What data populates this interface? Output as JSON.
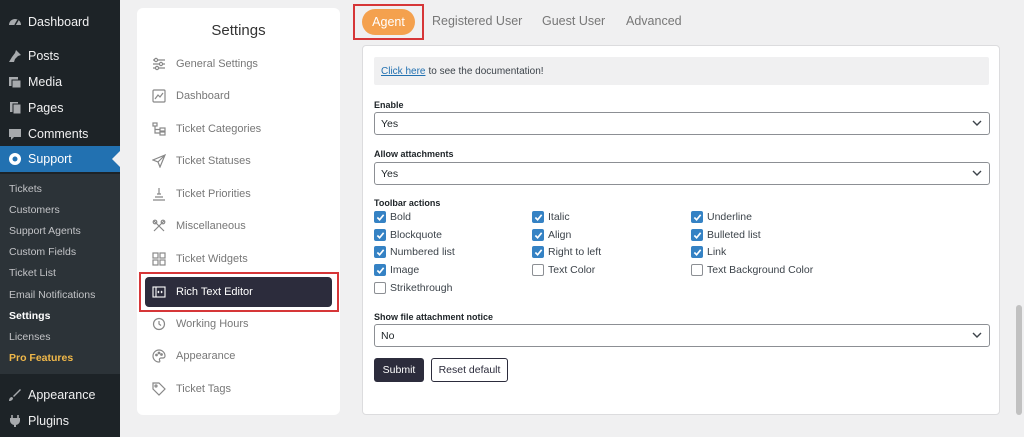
{
  "wp_menu": {
    "items": [
      {
        "label": "Dashboard",
        "icon": "dashboard-icon"
      },
      {
        "label": "Posts",
        "icon": "pin-icon"
      },
      {
        "label": "Media",
        "icon": "media-icon"
      },
      {
        "label": "Pages",
        "icon": "pages-icon"
      },
      {
        "label": "Comments",
        "icon": "comment-icon"
      },
      {
        "label": "Support",
        "icon": "lifebuoy-icon"
      },
      {
        "label": "Appearance",
        "icon": "brush-icon"
      },
      {
        "label": "Plugins",
        "icon": "plug-icon"
      }
    ],
    "submenu": [
      "Tickets",
      "Customers",
      "Support Agents",
      "Custom Fields",
      "Ticket List",
      "Email Notifications",
      "Settings",
      "Licenses",
      "Pro Features"
    ]
  },
  "settings_nav": {
    "title": "Settings",
    "items": [
      {
        "label": "General Settings",
        "icon": "sliders-icon"
      },
      {
        "label": "Dashboard",
        "icon": "chart-icon"
      },
      {
        "label": "Ticket Categories",
        "icon": "tree-icon"
      },
      {
        "label": "Ticket Statuses",
        "icon": "send-icon"
      },
      {
        "label": "Ticket Priorities",
        "icon": "priority-icon"
      },
      {
        "label": "Miscellaneous",
        "icon": "tools-icon"
      },
      {
        "label": "Ticket Widgets",
        "icon": "widgets-icon"
      },
      {
        "label": "Rich Text Editor",
        "icon": "code-editor-icon"
      },
      {
        "label": "Working Hours",
        "icon": "clock-icon"
      },
      {
        "label": "Appearance",
        "icon": "palette-icon"
      },
      {
        "label": "Ticket Tags",
        "icon": "tag-icon"
      }
    ]
  },
  "tabs": [
    "Agent",
    "Registered User",
    "Guest User",
    "Advanced"
  ],
  "form": {
    "doc_link": "Click here",
    "doc_text": "to see the documentation!",
    "enable_label": "Enable",
    "enable_value": "Yes",
    "attach_label": "Allow attachments",
    "attach_value": "Yes",
    "toolbar_label": "Toolbar actions",
    "toolbar": [
      {
        "label": "Bold",
        "checked": true
      },
      {
        "label": "Italic",
        "checked": true
      },
      {
        "label": "Underline",
        "checked": true
      },
      {
        "label": "Blockquote",
        "checked": true
      },
      {
        "label": "Align",
        "checked": true
      },
      {
        "label": "Bulleted list",
        "checked": true
      },
      {
        "label": "Numbered list",
        "checked": true
      },
      {
        "label": "Right to left",
        "checked": true
      },
      {
        "label": "Link",
        "checked": true
      },
      {
        "label": "Image",
        "checked": true
      },
      {
        "label": "Text Color",
        "checked": false
      },
      {
        "label": "Text Background Color",
        "checked": false
      },
      {
        "label": "Strikethrough",
        "checked": false
      }
    ],
    "notice_label": "Show file attachment notice",
    "notice_value": "No",
    "submit": "Submit",
    "reset": "Reset default"
  },
  "colors": {
    "accent": "#f4a14e",
    "wp_blue": "#2271b1",
    "dark": "#2c2c3c",
    "highlight": "#d63638"
  }
}
